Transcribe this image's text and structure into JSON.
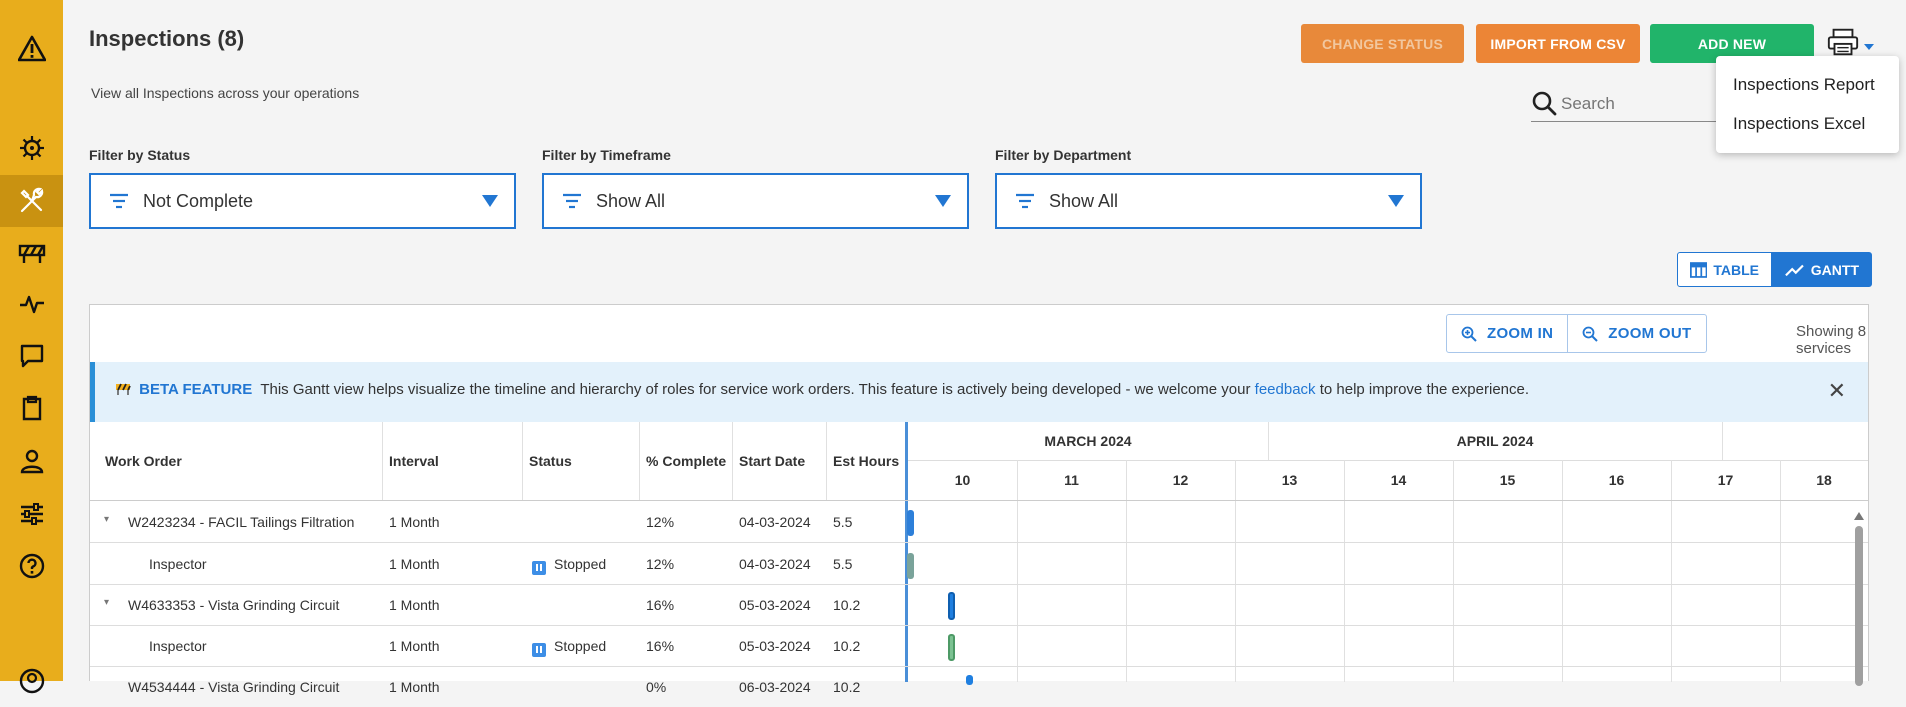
{
  "page": {
    "title": "Inspections (8)",
    "subtitle": "View all Inspections across your operations"
  },
  "actions": {
    "change_status": "CHANGE STATUS",
    "import_csv": "IMPORT FROM CSV",
    "add_new": "ADD NEW"
  },
  "print_menu": {
    "items": [
      "Inspections Report",
      "Inspections Excel"
    ]
  },
  "search": {
    "placeholder": "Search",
    "value": ""
  },
  "filters": [
    {
      "label": "Filter by Status",
      "value": "Not Complete"
    },
    {
      "label": "Filter by Timeframe",
      "value": "Show All"
    },
    {
      "label": "Filter by Department",
      "value": "Show All"
    }
  ],
  "view_toggle": {
    "table": "TABLE",
    "gantt": "GANTT",
    "active": "gantt"
  },
  "gantt": {
    "zoom_in": "ZOOM IN",
    "zoom_out": "ZOOM OUT",
    "showing": "Showing 8 services",
    "beta": {
      "icon": "construction-barrier-icon",
      "tag": "BETA FEATURE",
      "text_before": "This Gantt view helps visualize the timeline and hierarchy of roles for service work orders. This feature is actively being developed - we welcome your",
      "link": "feedback",
      "text_after": "to help improve the experience."
    },
    "columns": [
      "Work Order",
      "Interval",
      "Status",
      "% Complete",
      "Start Date",
      "Est Hours"
    ],
    "months": [
      "MARCH 2024",
      "APRIL 2024"
    ],
    "days": [
      "10",
      "11",
      "12",
      "13",
      "14",
      "15",
      "16",
      "17",
      "18"
    ],
    "rows": [
      {
        "work_order": "W2423234 - FACIL Tailings Filtration",
        "interval": "1 Month",
        "status": "",
        "complete": "12%",
        "start": "04-03-2024",
        "hours": "5.5",
        "child": false
      },
      {
        "work_order": "Inspector",
        "interval": "1 Month",
        "status": "Stopped",
        "complete": "12%",
        "start": "04-03-2024",
        "hours": "5.5",
        "child": true
      },
      {
        "work_order": "W4633353 - Vista Grinding Circuit",
        "interval": "1 Month",
        "status": "",
        "complete": "16%",
        "start": "05-03-2024",
        "hours": "10.2",
        "child": false
      },
      {
        "work_order": "Inspector",
        "interval": "1 Month",
        "status": "Stopped",
        "complete": "16%",
        "start": "05-03-2024",
        "hours": "10.2",
        "child": true
      },
      {
        "work_order": "W4534444 - Vista Grinding Circuit",
        "interval": "1 Month",
        "status": "",
        "complete": "0%",
        "start": "06-03-2024",
        "hours": "10.2",
        "child": false
      }
    ]
  },
  "sidebar": {
    "items": [
      "warning-icon",
      "virus-icon",
      "tools-icon",
      "barrier-icon",
      "pulse-icon",
      "chat-icon",
      "clipboard-icon",
      "user-icon",
      "sliders-icon",
      "help-icon",
      "account-icon"
    ]
  },
  "colors": {
    "accent": "#2176d2",
    "sidebar": "#e8ad1c",
    "orange": "#ec8536",
    "green": "#21b46a"
  }
}
